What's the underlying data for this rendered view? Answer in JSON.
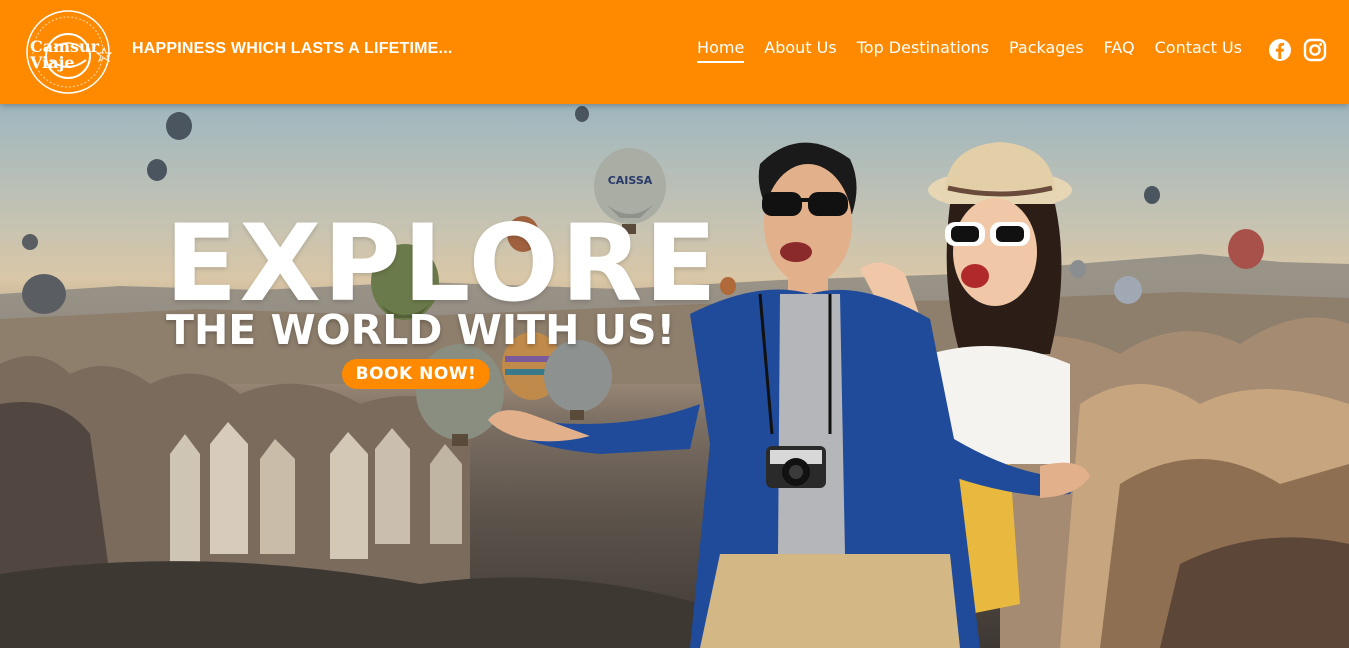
{
  "header": {
    "logo": {
      "line1": "Camsur",
      "line2": "Viaje",
      "ring_text": "HAPPINESS WHICH LASTS A LIFETIME"
    },
    "tagline": "HAPPINESS WHICH LASTS A LIFETIME...",
    "nav": [
      {
        "label": "Home",
        "active": true
      },
      {
        "label": "About Us",
        "active": false
      },
      {
        "label": "Top Destinations",
        "active": false
      },
      {
        "label": "Packages",
        "active": false
      },
      {
        "label": "FAQ",
        "active": false
      },
      {
        "label": "Contact Us",
        "active": false
      }
    ],
    "social": [
      {
        "icon": "facebook-icon"
      },
      {
        "icon": "instagram-icon"
      }
    ]
  },
  "hero": {
    "headline": "EXPLORE",
    "subheadline": "THE WORLD WITH US!",
    "cta_label": "BOOK NOW!",
    "balloon_text": "CAISSA"
  },
  "colors": {
    "brand_orange": "#ff8a00",
    "white": "#ffffff",
    "shirt_blue": "#1f4b9a"
  }
}
